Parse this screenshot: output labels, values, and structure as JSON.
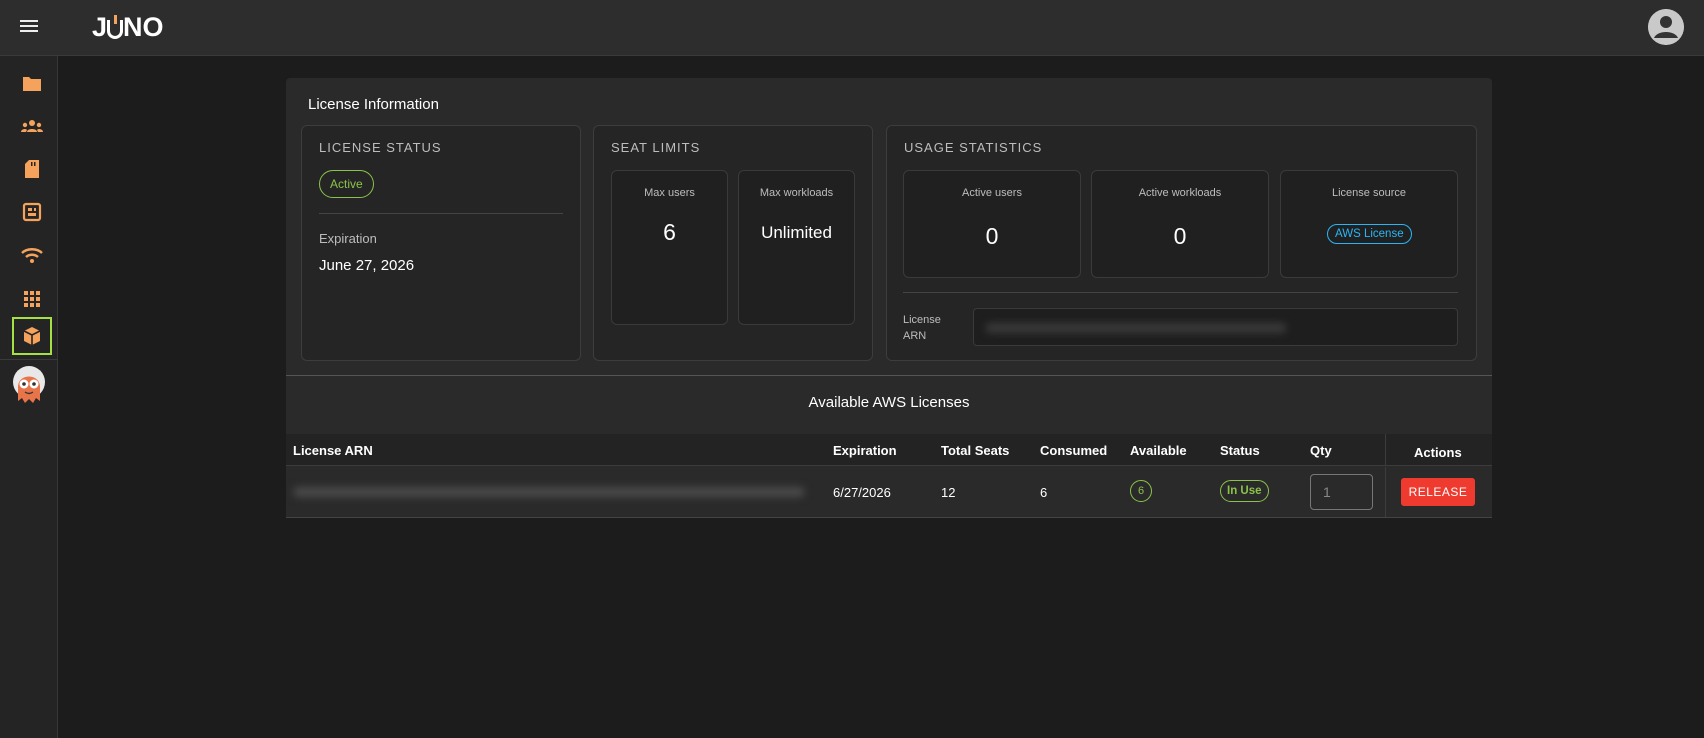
{
  "app": {
    "logo_text_before": "J",
    "logo_text_after": "NO"
  },
  "sidebar": {
    "items": [
      {
        "icon": "folder-icon"
      },
      {
        "icon": "groups-icon"
      },
      {
        "icon": "sd-card-icon"
      },
      {
        "icon": "chip-board-icon"
      },
      {
        "icon": "wifi-icon"
      },
      {
        "icon": "apps-grid-icon"
      },
      {
        "icon": "package-icon",
        "selected": true
      }
    ],
    "accent": "#f5a25d",
    "selected_border": "#a4e241"
  },
  "card": {
    "title": "License Information",
    "license_status": {
      "title": "LICENSE STATUS",
      "status": "Active",
      "expiration_label": "Expiration",
      "expiration_value": "June 27, 2026"
    },
    "seat_limits": {
      "title": "SEAT LIMITS",
      "max_users_label": "Max users",
      "max_users_value": "6",
      "max_workloads_label": "Max workloads",
      "max_workloads_value": "Unlimited"
    },
    "usage": {
      "title": "USAGE STATISTICS",
      "active_users_label": "Active users",
      "active_users_value": "0",
      "active_workloads_label": "Active workloads",
      "active_workloads_value": "0",
      "license_source_label": "License source",
      "license_source_value": "AWS License",
      "arn_label": "License ARN"
    }
  },
  "available": {
    "title": "Available AWS Licenses",
    "columns": [
      "License ARN",
      "Expiration",
      "Total Seats",
      "Consumed",
      "Available",
      "Status",
      "Qty",
      "Actions"
    ],
    "rows": [
      {
        "expiration": "6/27/2026",
        "total_seats": "12",
        "consumed": "6",
        "available": "6",
        "status": "In Use",
        "qty": "1",
        "action": "RELEASE"
      }
    ]
  },
  "colors": {
    "success": "#8bc34a",
    "info": "#29b6f6",
    "danger": "#ef3b2f"
  }
}
